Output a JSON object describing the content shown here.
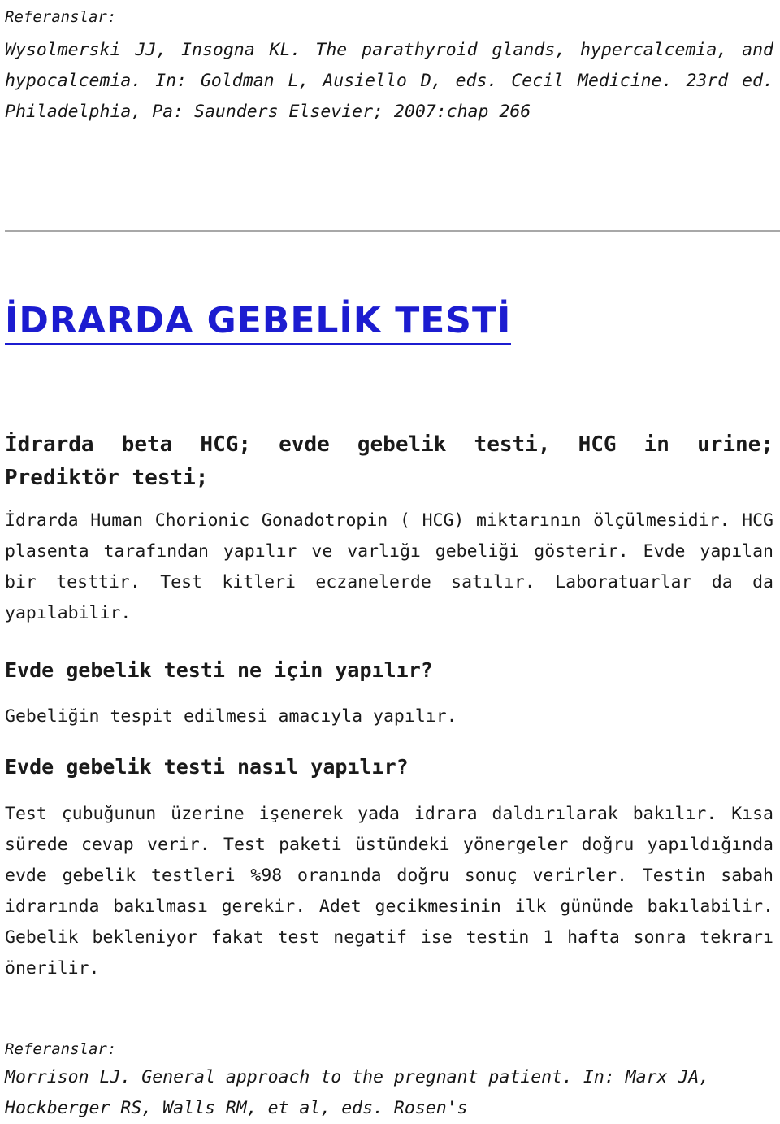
{
  "document": {
    "language": "tr",
    "accent_color": "#1c1cd0",
    "text_color": "#1a1a1a",
    "rule_color": "#a8a8a8"
  },
  "top_reference": {
    "label": "Referanslar:",
    "citation": "Wysolmerski JJ, Insogna KL. The parathyroid glands, hypercalcemia, and hypocalcemia. In: Goldman L, Ausiello D, eds. Cecil Medicine. 23rd ed. Philadelphia, Pa: Saunders Elsevier; 2007:chap 266"
  },
  "article": {
    "title": "İDRARDA GEBELİK TESTİ",
    "subtitle": "İdrarda beta HCG; evde gebelik testi, HCG in urine; Prediktör testi;",
    "intro": "İdrarda Human Chorionic Gonadotropin ( HCG) miktarının ölçülmesidir. HCG plasenta tarafından yapılır ve varlığı gebeliği gösterir. Evde yapılan bir testtir. Test kitleri eczanelerde satılır. Laboratuarlar da da yapılabilir.",
    "sections": [
      {
        "heading": "Evde gebelik testi ne için yapılır?",
        "body": "Gebeliğin tespit edilmesi amacıyla yapılır."
      },
      {
        "heading": "Evde gebelik testi nasıl yapılır?",
        "body": "Test çubuğunun üzerine işenerek yada idrara daldırılarak bakılır. Kısa sürede cevap verir. Test paketi üstündeki yönergeler doğru yapıldığında evde gebelik testleri %98 oranında doğru sonuç verirler.  Testin sabah idrarında bakılması gerekir. Adet gecikmesinin ilk gününde bakılabilir. Gebelik bekleniyor fakat test negatif ise testin 1 hafta sonra tekrarı önerilir."
      }
    ]
  },
  "bottom_reference": {
    "label": "Referanslar:",
    "citation": "Morrison LJ. General approach to the pregnant patient. In: Marx JA, Hockberger RS, Walls RM, et al, eds. Rosen's"
  }
}
